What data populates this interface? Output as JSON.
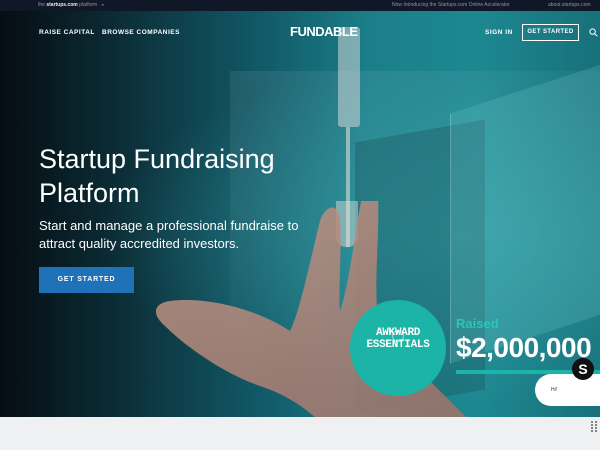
{
  "topbar": {
    "prefix": "the",
    "brand": "startups.com",
    "suffix": "platform",
    "announcement": "Now Introducing the Startups.com Online Accelerator",
    "about_link": "about.startups.com"
  },
  "header": {
    "logo": "FUNDABLE",
    "nav_left": [
      "RAISE CAPITAL",
      "BROWSE COMPANIES"
    ],
    "sign_in": "SIGN IN",
    "get_started": "GET STARTED"
  },
  "hero": {
    "title": "Startup Fundraising Platform",
    "subtitle": "Start and manage a professional fundraise to attract quality accredited investors.",
    "cta": "GET STARTED"
  },
  "feature": {
    "badge_text": "AWKWARD ESSENTIALS",
    "raised_label": "Raised",
    "raised_amount": "$2,000,000",
    "chat_text": "Hi!",
    "chat_badge": "S"
  }
}
